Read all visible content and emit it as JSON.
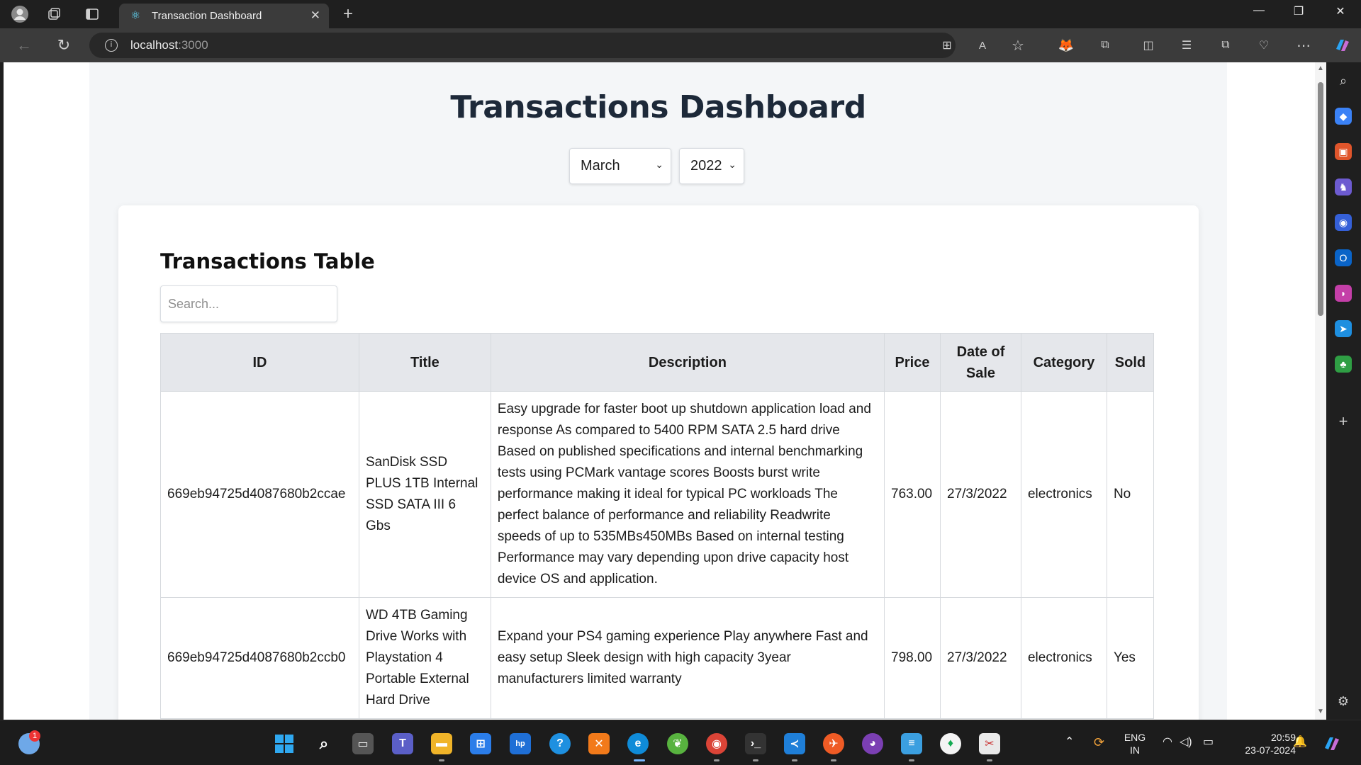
{
  "browser": {
    "tab_title": "Transaction Dashboard",
    "url_host": "localhost",
    "url_port": ":3000"
  },
  "dashboard": {
    "title": "Transactions Dashboard",
    "month_select": {
      "value": "March"
    },
    "year_select": {
      "value": "2022"
    }
  },
  "table_section": {
    "title": "Transactions Table",
    "search_placeholder": "Search...",
    "columns": [
      "ID",
      "Title",
      "Description",
      "Price",
      "Date of Sale",
      "Category",
      "Sold"
    ],
    "rows": [
      {
        "id": "669eb94725d4087680b2ccae",
        "title": "SanDisk SSD PLUS 1TB Internal SSD SATA III 6 Gbs",
        "description": "Easy upgrade for faster boot up shutdown application load and response As compared to 5400 RPM SATA 2.5 hard drive Based on published specifications and internal benchmarking tests using PCMark vantage scores Boosts burst write performance making it ideal for typical PC workloads The perfect balance of performance and reliability Readwrite speeds of up to 535MBs450MBs Based on internal testing Performance may vary depending upon drive capacity host device OS and application.",
        "price": "763.00",
        "date": "27/3/2022",
        "category": "electronics",
        "sold": "No"
      },
      {
        "id": "669eb94725d4087680b2ccb0",
        "title": "WD 4TB Gaming Drive Works with Playstation 4 Portable External Hard Drive",
        "description": "Expand your PS4 gaming experience Play anywhere Fast and easy setup Sleek design with high capacity 3year manufacturers limited warranty",
        "price": "798.00",
        "date": "27/3/2022",
        "category": "electronics",
        "sold": "Yes"
      }
    ]
  },
  "taskbar": {
    "weather_badge": "1",
    "lang_line1": "ENG",
    "lang_line2": "IN",
    "time": "20:59",
    "date": "23-07-2024"
  }
}
